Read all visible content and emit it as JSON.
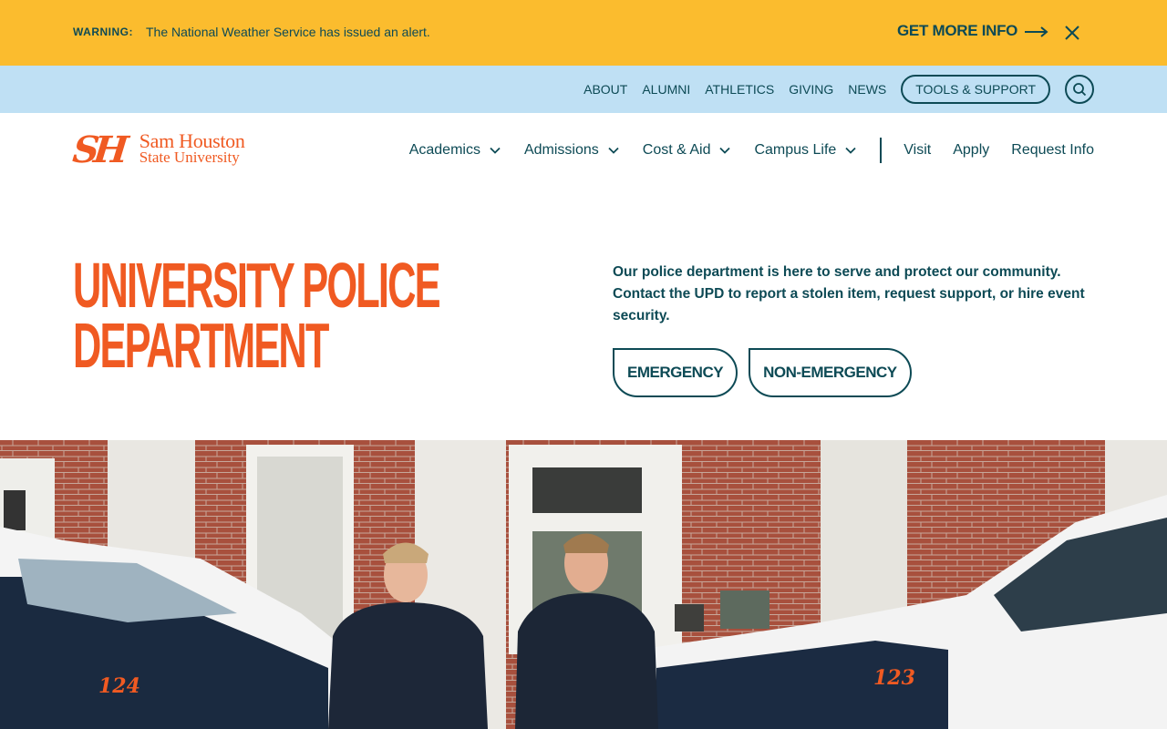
{
  "alert": {
    "label": "WARNING:",
    "message": "The National Weather Service has issued an alert.",
    "link_label": "GET MORE INFO",
    "close_icon": "close-icon",
    "background": "#fbbc2e"
  },
  "utility": {
    "links": [
      "ABOUT",
      "ALUMNI",
      "ATHLETICS",
      "GIVING",
      "NEWS"
    ],
    "tools_label": "TOOLS & SUPPORT",
    "search_icon": "search-icon",
    "background": "#bfe0f4"
  },
  "brand": {
    "mark": "SH",
    "line1": "Sam Houston",
    "line2": "State University",
    "color": "#f05a22"
  },
  "nav": {
    "menus": [
      "Academics",
      "Admissions",
      "Cost & Aid",
      "Campus Life"
    ],
    "links": [
      "Visit",
      "Apply",
      "Request Info"
    ]
  },
  "hero": {
    "title_line1": "UNIVERSITY POLICE",
    "title_line2": "DEPARTMENT",
    "description": "Our police department is here to serve and protect our community. Contact the UPD to report a stolen item, request support, or hire event security.",
    "buttons": [
      "EMERGENCY",
      "NON-EMERGENCY"
    ]
  },
  "photo": {
    "car_left_number": "124",
    "car_right_number": "123"
  },
  "colors": {
    "primary_text": "#0d4a55",
    "accent": "#f05a22"
  }
}
